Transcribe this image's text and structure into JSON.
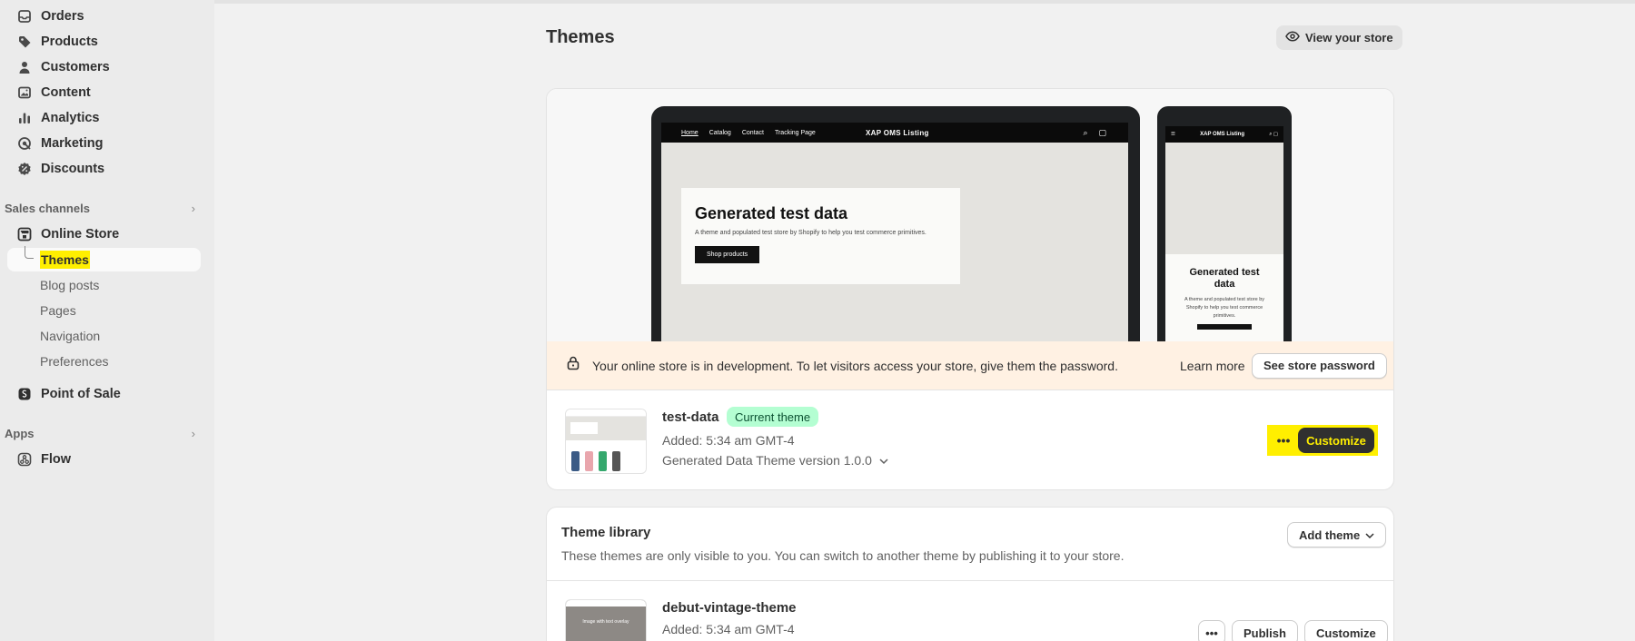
{
  "sidebar": {
    "items": [
      {
        "label": "Orders",
        "icon": "inbox-icon"
      },
      {
        "label": "Products",
        "icon": "tag-icon"
      },
      {
        "label": "Customers",
        "icon": "person-icon"
      },
      {
        "label": "Content",
        "icon": "image-icon"
      },
      {
        "label": "Analytics",
        "icon": "bar-chart-icon"
      },
      {
        "label": "Marketing",
        "icon": "target-icon"
      },
      {
        "label": "Discounts",
        "icon": "discount-icon"
      }
    ],
    "sales_channels_label": "Sales channels",
    "online_store_label": "Online Store",
    "subitems": [
      "Themes",
      "Blog posts",
      "Pages",
      "Navigation",
      "Preferences"
    ],
    "pos_label": "Point of Sale",
    "apps_label": "Apps",
    "flow_label": "Flow"
  },
  "header": {
    "title": "Themes",
    "view_store_label": "View your store"
  },
  "preview": {
    "nav_links": [
      "Home",
      "Catalog",
      "Contact",
      "Tracking Page"
    ],
    "store_name": "XAP OMS Listing",
    "hero_title": "Generated test data",
    "hero_text": "A theme and populated test store by Shopify to help you test commerce primitives.",
    "hero_button": "Shop products",
    "mobile_store_name": "XAP OMS Listing",
    "mobile_hero_title": "Generated test data",
    "mobile_hero_text": "A theme and populated test store by Shopify to help you test commerce primitives."
  },
  "banner": {
    "message": "Your online store is in development. To let visitors access your store, give them the password.",
    "learn_more": "Learn more",
    "password_button": "See store password"
  },
  "current_theme": {
    "name": "test-data",
    "badge": "Current theme",
    "added": "Added: 5:34 am GMT-4",
    "version": "Generated Data Theme version 1.0.0",
    "more_label": "•••",
    "customize_label": "Customize"
  },
  "library": {
    "title": "Theme library",
    "subtitle": "These themes are only visible to you. You can switch to another theme by publishing it to your store.",
    "add_theme_label": "Add theme",
    "themes": [
      {
        "name": "debut-vintage-theme",
        "added": "Added: 5:34 am GMT-4",
        "thumb_text": "Image with text overlay",
        "more_label": "•••",
        "publish_label": "Publish",
        "customize_label": "Customize"
      }
    ]
  },
  "colors": {
    "highlight": "#ffef00",
    "badge_bg": "#b4fed2",
    "banner_bg": "#fff1e3"
  }
}
